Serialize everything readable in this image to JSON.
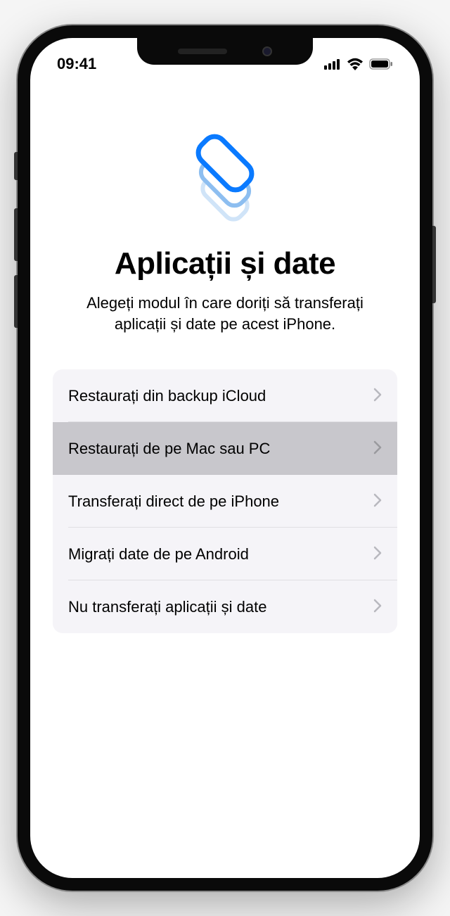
{
  "status_bar": {
    "time": "09:41"
  },
  "screen": {
    "title": "Aplicații și date",
    "subtitle": "Alegeți modul în care doriți să transferați aplicații și date pe acest iPhone."
  },
  "options": [
    {
      "label": "Restaurați din backup iCloud",
      "highlighted": false
    },
    {
      "label": "Restaurați de pe Mac sau PC",
      "highlighted": true
    },
    {
      "label": "Transferați direct de pe iPhone",
      "highlighted": false
    },
    {
      "label": "Migrați date de pe Android",
      "highlighted": false
    },
    {
      "label": "Nu transferați aplicații și date",
      "highlighted": false
    }
  ]
}
